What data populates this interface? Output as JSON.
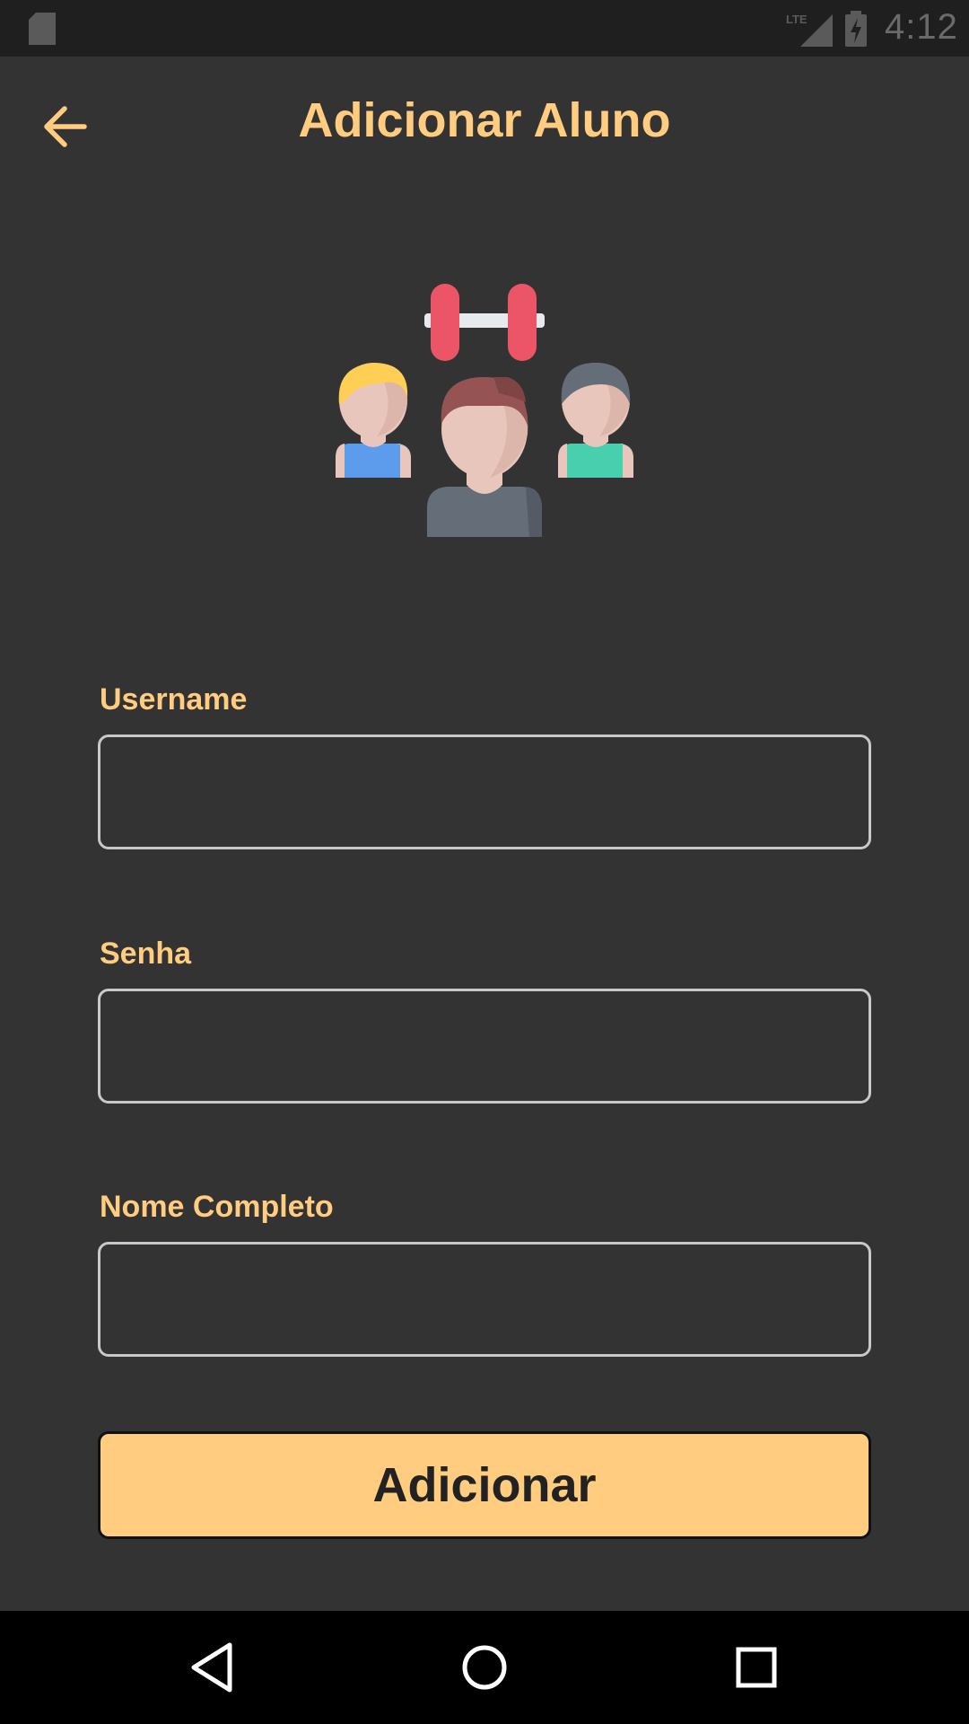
{
  "status_bar": {
    "time": "4:12",
    "network_label": "LTE",
    "icons": [
      "sd-card-icon",
      "lte-signal-icon",
      "battery-charging-icon"
    ]
  },
  "header": {
    "title": "Adicionar Aluno",
    "back_icon": "arrow-back-icon"
  },
  "hero": {
    "icon": "gym-students-illustration"
  },
  "form": {
    "username": {
      "label": "Username",
      "value": "",
      "placeholder": ""
    },
    "password": {
      "label": "Senha",
      "value": "",
      "placeholder": ""
    },
    "full_name": {
      "label": "Nome Completo",
      "value": "",
      "placeholder": ""
    },
    "submit_label": "Adicionar"
  },
  "nav_bar": {
    "icons": [
      "back-triangle-icon",
      "home-circle-icon",
      "recents-square-icon"
    ]
  },
  "colors": {
    "background": "#333333",
    "accent": "#ffcc80",
    "status_bar": "#1f1f1f",
    "nav_bar": "#000000",
    "input_border": "#c8c8c8"
  }
}
